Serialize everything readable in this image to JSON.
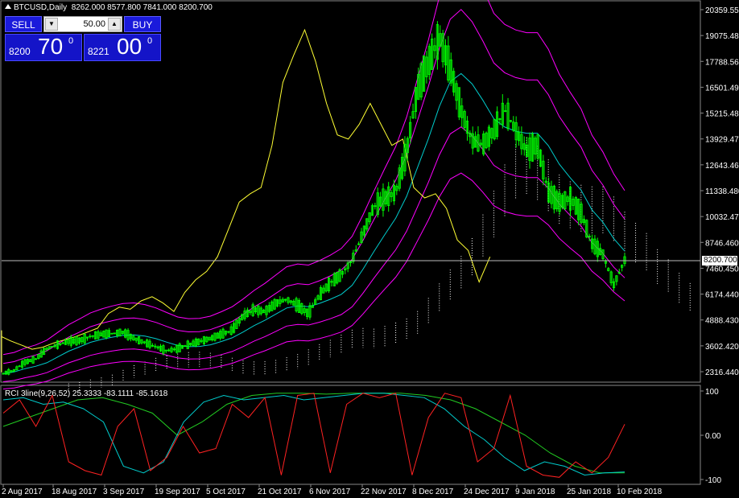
{
  "header": {
    "symbol": "BTCUSD,Daily",
    "ohlc": "8262.000 8577.800 7841.000 8200.700"
  },
  "trade_panel": {
    "sell_label": "SELL",
    "buy_label": "BUY",
    "lot_value": "50.00",
    "bid_small": "8200",
    "bid_big": "70",
    "bid_sup": "0",
    "ask_small": "8221",
    "ask_big": "00",
    "ask_sup": "0"
  },
  "current_price_label": "8200.700",
  "indicator_label": "RCI 3line(9,26,52) 25.3333 -83.1111 -85.1618",
  "colors": {
    "background": "#000000",
    "candles": "#00ff00",
    "bollinger": "#ff00ff",
    "ma": "#00cccc",
    "lagging": "#ffff33",
    "cloud": "#ffffff",
    "rci_short": "#ff2222",
    "rci_mid": "#00cccc",
    "rci_long": "#22cc22"
  },
  "chart_data": {
    "type": "candlestick",
    "y_axis_ticks": [
      "20359.550",
      "19075.480",
      "17788.560",
      "16501.490",
      "15215.480",
      "13929.470",
      "12643.460",
      "11338.480",
      "10032.470",
      "8746.460",
      "7460.450",
      "6174.440",
      "4888.430",
      "3602.420",
      "2316.440"
    ],
    "ylim": [
      2316.44,
      20359.55
    ],
    "x_axis_ticks": [
      "2 Aug 2017",
      "18 Aug 2017",
      "3 Sep 2017",
      "19 Sep 2017",
      "5 Oct 2017",
      "21 Oct 2017",
      "6 Nov 2017",
      "22 Nov 2017",
      "8 Dec 2017",
      "24 Dec 2017",
      "9 Jan 2018",
      "25 Jan 2018",
      "10 Feb 2018"
    ],
    "close_series": [
      2700,
      2850,
      3250,
      3400,
      3900,
      4100,
      4250,
      4300,
      4500,
      4600,
      4650,
      4700,
      4400,
      4200,
      4000,
      3800,
      3900,
      4100,
      4250,
      4400,
      4600,
      4800,
      5500,
      5800,
      5700,
      6100,
      6300,
      6000,
      5600,
      6500,
      7100,
      7500,
      8200,
      9500,
      10800,
      11200,
      11500,
      13500,
      16500,
      17800,
      19000,
      17500,
      15500,
      14000,
      13800,
      14500,
      15500,
      14500,
      13500,
      13800,
      11500,
      11000,
      11200,
      10500,
      9000,
      8500,
      7000,
      8200
    ],
    "rci_indicator": {
      "ylim": [
        -100,
        100
      ],
      "ticks": [
        "100",
        "0.00",
        "-100"
      ],
      "short": [
        50,
        80,
        20,
        90,
        -60,
        -80,
        -90,
        20,
        60,
        -80,
        -50,
        20,
        -40,
        -30,
        70,
        40,
        85,
        -90,
        90,
        95,
        -85,
        70,
        95,
        85,
        95,
        -90,
        40,
        95,
        85,
        -60,
        -30,
        90,
        -70,
        -90,
        -95,
        -60,
        -85,
        -50,
        25
      ],
      "mid": [
        80,
        85,
        70,
        75,
        60,
        30,
        -70,
        -85,
        -60,
        30,
        75,
        90,
        80,
        85,
        90,
        80,
        85,
        90,
        95,
        95,
        90,
        85,
        60,
        20,
        -10,
        -50,
        -80,
        -60,
        -70,
        -90,
        -85,
        -83
      ],
      "long": [
        20,
        40,
        60,
        80,
        85,
        70,
        50,
        0,
        30,
        70,
        90,
        95,
        95,
        93,
        95,
        95,
        95,
        90,
        80,
        60,
        30,
        0,
        -40,
        -70,
        -85,
        -85
      ]
    }
  }
}
